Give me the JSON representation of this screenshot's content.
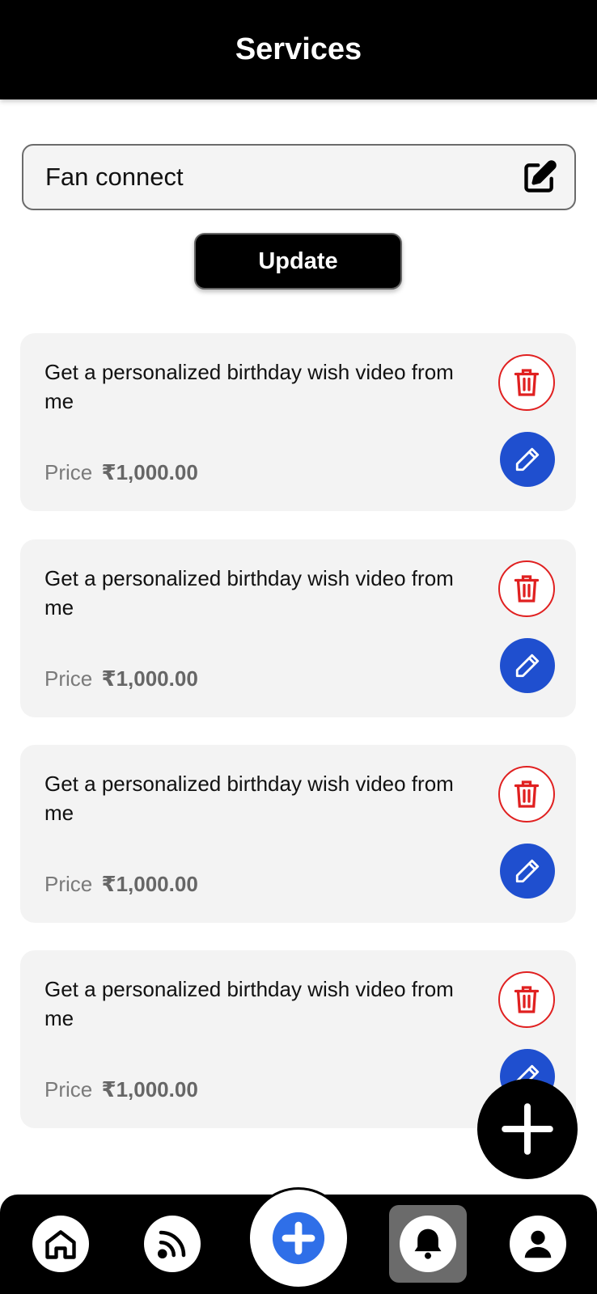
{
  "header": {
    "title": "Services"
  },
  "service_name": {
    "value": "Fan connect"
  },
  "update_button": {
    "label": "Update"
  },
  "services": [
    {
      "title": "Get a personalized birthday wish video from me",
      "price_label": "Price",
      "price": "₹1,000.00"
    },
    {
      "title": "Get a personalized birthday wish video from me",
      "price_label": "Price",
      "price": "₹1,000.00"
    },
    {
      "title": "Get a personalized birthday wish video from me",
      "price_label": "Price",
      "price": "₹1,000.00"
    },
    {
      "title": "Get a personalized birthday wish video from me",
      "price_label": "Price",
      "price": "₹1,000.00"
    }
  ],
  "colors": {
    "delete": "#e02020",
    "edit": "#1f4fcf",
    "active_tab": "#6b6b6b"
  },
  "bottom_nav": {
    "items": [
      {
        "name": "home",
        "icon": "home-icon"
      },
      {
        "name": "feed",
        "icon": "rss-icon"
      },
      {
        "name": "create",
        "icon": "plus-circle-icon"
      },
      {
        "name": "notifications",
        "icon": "bell-icon",
        "active": true
      },
      {
        "name": "profile",
        "icon": "user-icon"
      }
    ]
  }
}
